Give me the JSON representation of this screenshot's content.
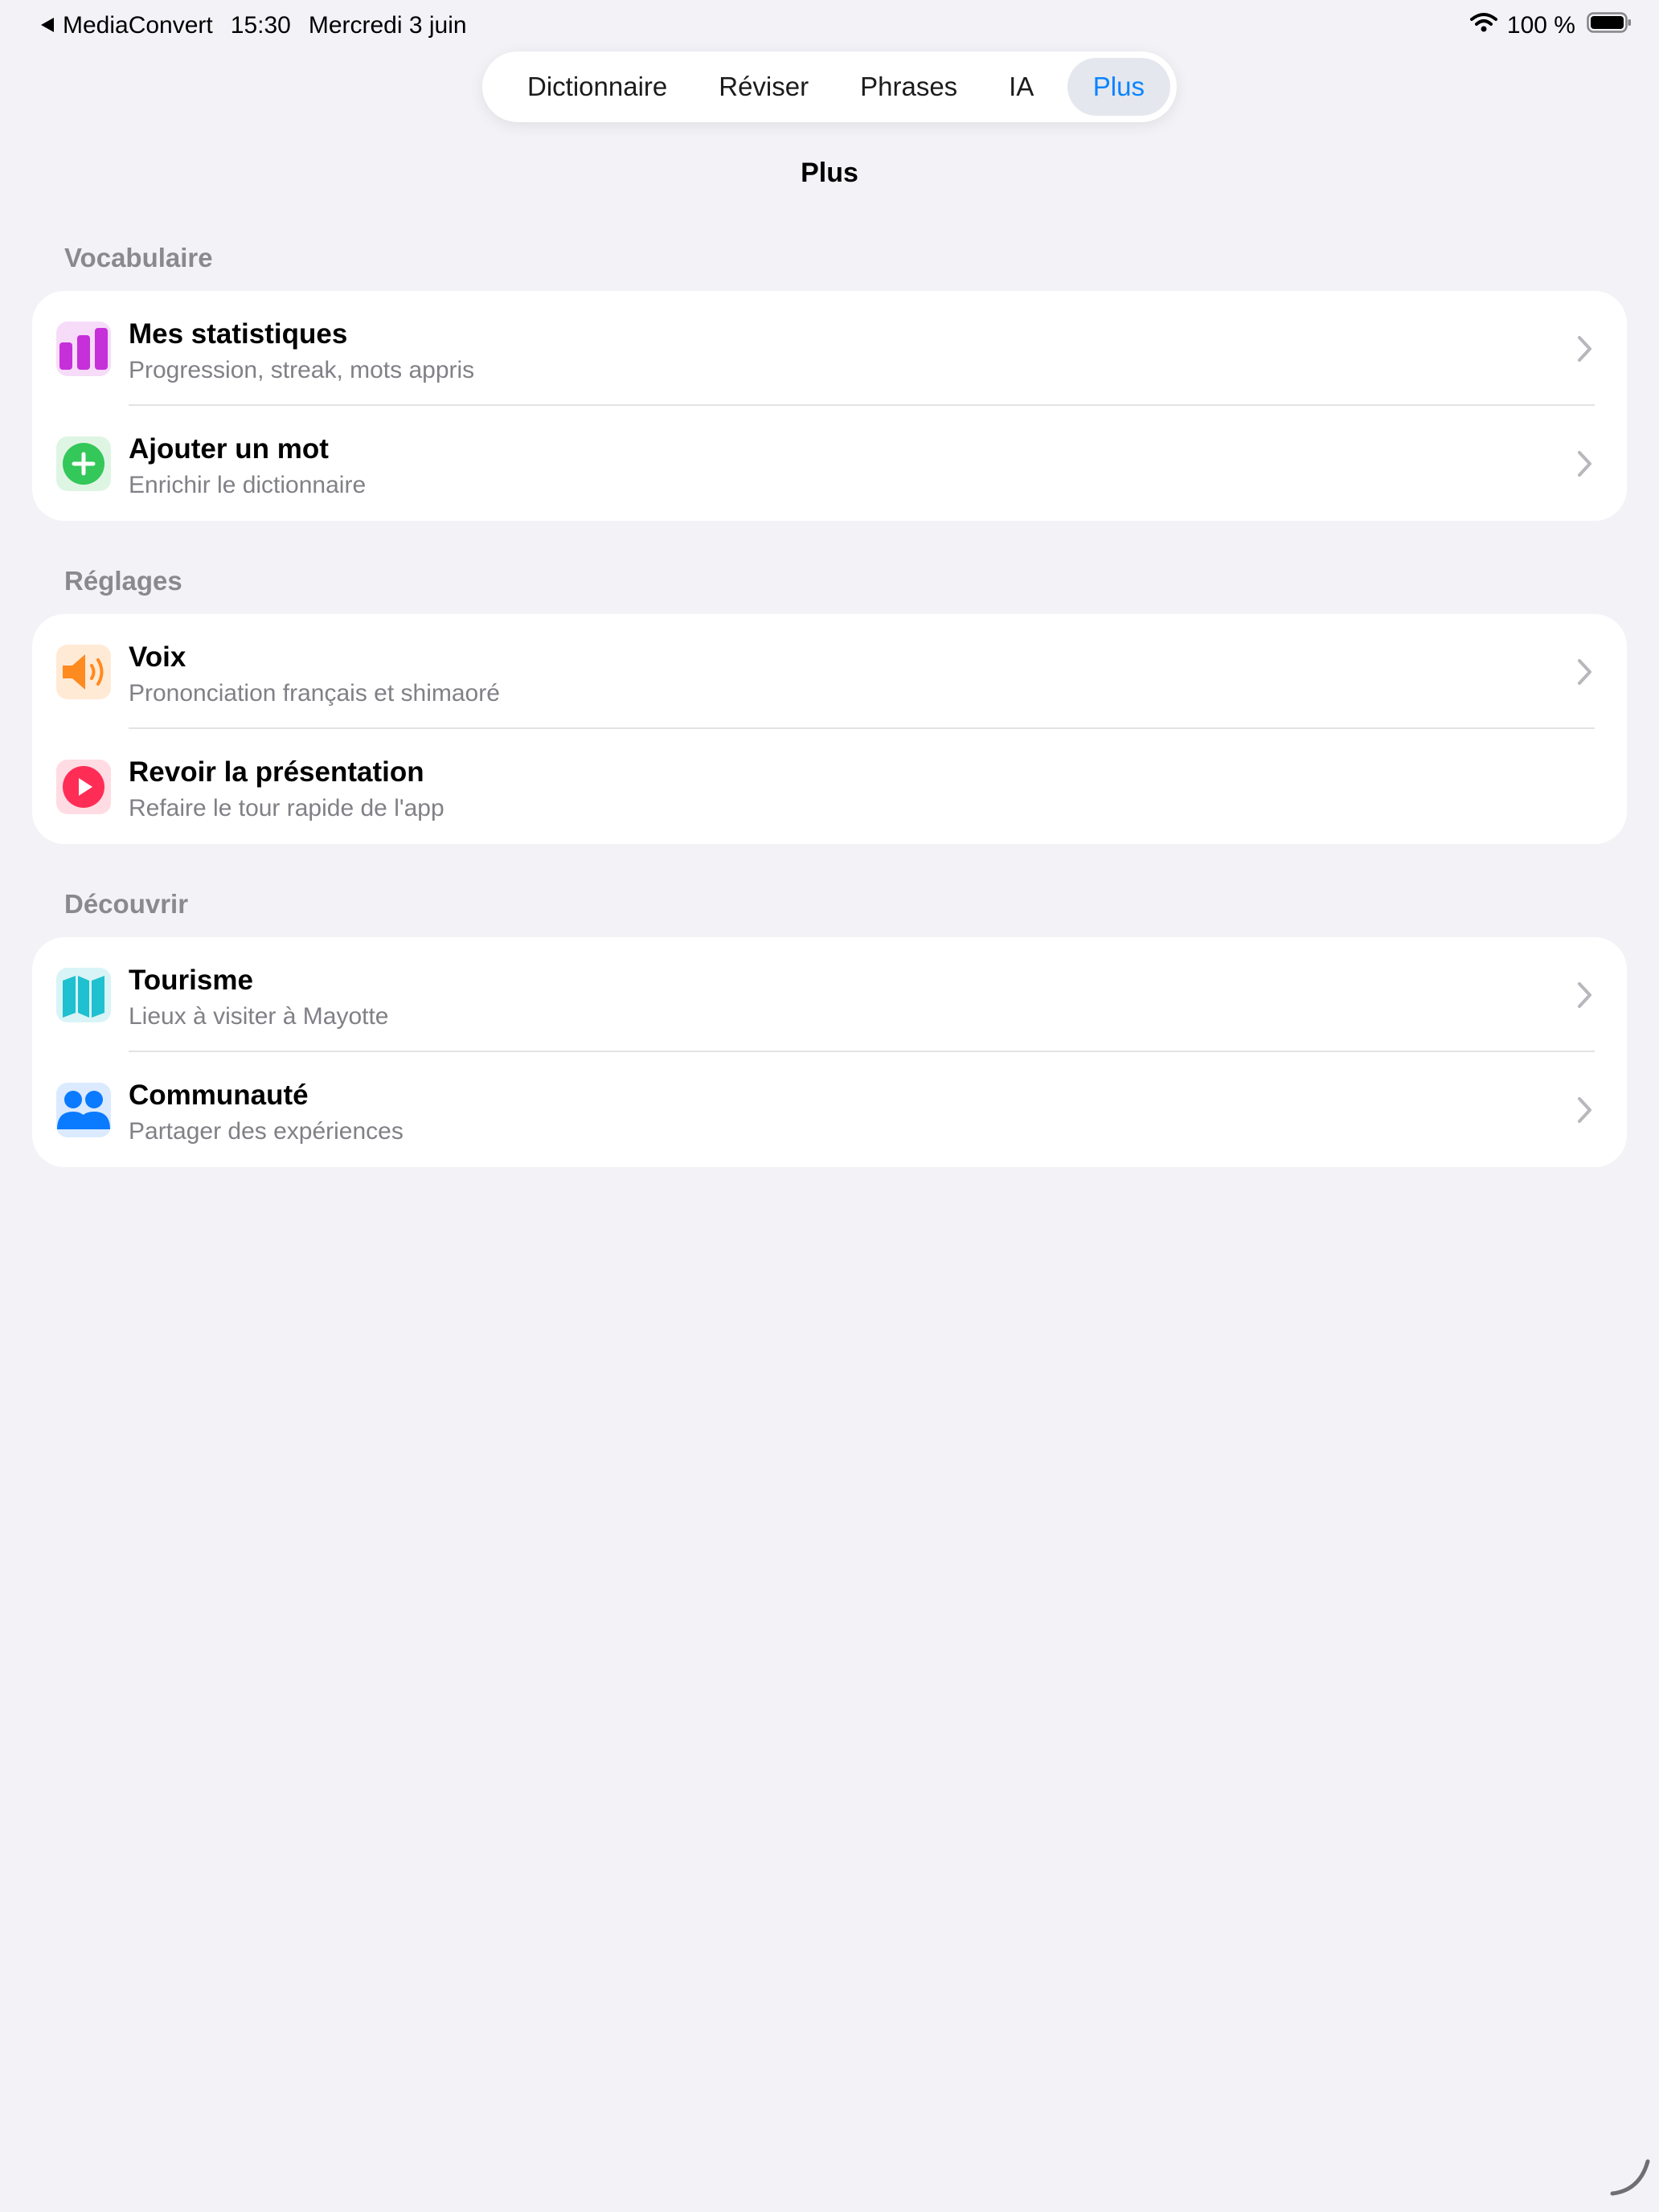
{
  "status_bar": {
    "back_app": "MediaConvert",
    "time": "15:30",
    "date": "Mercredi 3 juin",
    "battery": "100 %"
  },
  "tabs": [
    {
      "label": "Dictionnaire"
    },
    {
      "label": "Réviser"
    },
    {
      "label": "Phrases"
    },
    {
      "label": "IA"
    },
    {
      "label": "Plus",
      "active": true
    }
  ],
  "page_title": "Plus",
  "sections": [
    {
      "header": "Vocabulaire",
      "items": [
        {
          "title": "Mes statistiques",
          "subtitle": "Progression, streak, mots appris",
          "icon": "bar-chart-icon",
          "color": "#c530d9",
          "tint": "#f6dcf9",
          "chevron": true
        },
        {
          "title": "Ajouter un mot",
          "subtitle": "Enrichir le dictionnaire",
          "icon": "plus-circle-icon",
          "color": "#34c759",
          "tint": "#dff5e4",
          "chevron": true
        }
      ]
    },
    {
      "header": "Réglages",
      "items": [
        {
          "title": "Voix",
          "subtitle": "Prononciation français et shimaoré",
          "icon": "speaker-icon",
          "color": "#ff8a1f",
          "tint": "#ffead6",
          "chevron": true
        },
        {
          "title": "Revoir la présentation",
          "subtitle": "Refaire le tour rapide de l'app",
          "icon": "play-circle-icon",
          "color": "#ff2d55",
          "tint": "#ffdce3",
          "chevron": false
        }
      ]
    },
    {
      "header": "Découvrir",
      "items": [
        {
          "title": "Tourisme",
          "subtitle": "Lieux à visiter à Mayotte",
          "icon": "map-icon",
          "color": "#1fc0cf",
          "tint": "#d9f4f6",
          "chevron": true
        },
        {
          "title": "Communauté",
          "subtitle": "Partager des expériences",
          "icon": "people-icon",
          "color": "#0a7aff",
          "tint": "#dbeaff",
          "chevron": true
        }
      ]
    }
  ]
}
